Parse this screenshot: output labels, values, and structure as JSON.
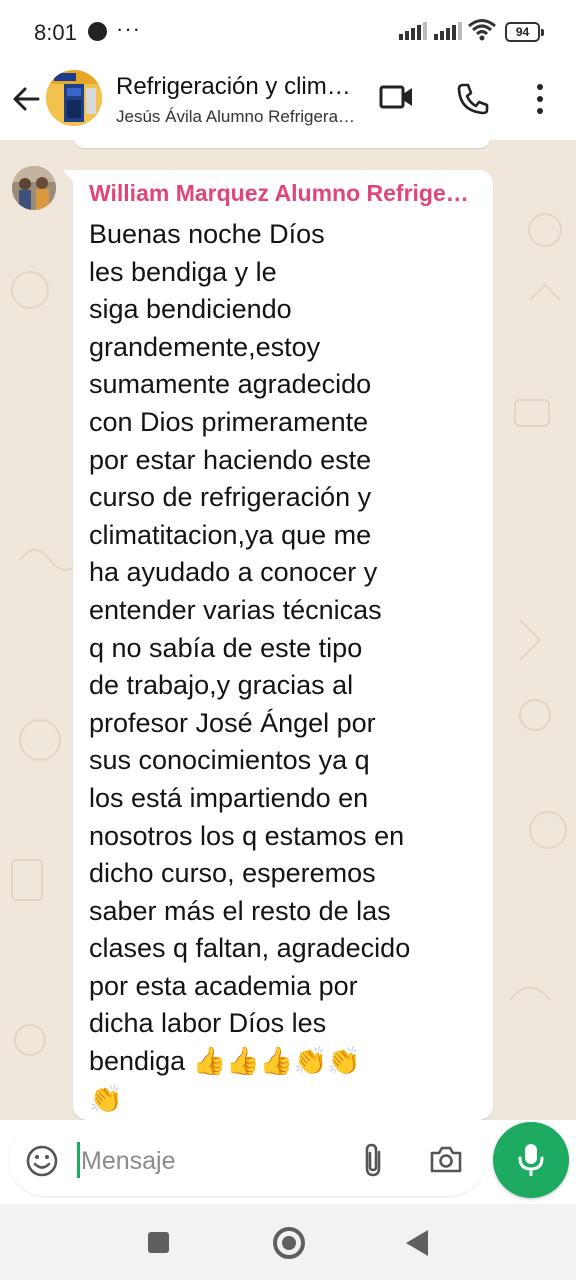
{
  "status_bar": {
    "time": "8:01",
    "more": "···",
    "battery": "94"
  },
  "header": {
    "title": "Refrigeración y climatización",
    "subtitle": "Jesús Ávila Alumno Refrigeración"
  },
  "message": {
    "sender": "William Marquez Alumno Refrigeración",
    "sender_color": "#e0457b",
    "text": "Buenas noche Díos\nles bendiga y le\nsiga bendiciendo\ngrandemente,estoy\nsumamente agradecido\ncon Dios primeramente\npor estar haciendo este\ncurso de refrigeración y\nclimatitacion,ya que me\nha ayudado a conocer y\nentender varias técnicas\nq no sabía de este tipo\nde trabajo,y gracias al\nprofesor José Ángel por\nsus conocimientos ya q\nlos está impartiendo en\nnosotros los q estamos en\ndicho curso, esperemos\nsaber más el resto de las\nclases q faltan, agradecido\npor esta academia por\ndicha labor Díos les\nbendiga 👍👍👍👏👏\n👏"
  },
  "input": {
    "placeholder": "Mensaje"
  },
  "colors": {
    "accent_green": "#1daa61",
    "chat_background": "#efe7dc"
  },
  "icons": [
    "back-arrow-icon",
    "video-call-icon",
    "phone-icon",
    "more-vert-icon",
    "emoji-icon",
    "attach-icon",
    "camera-icon",
    "mic-icon"
  ]
}
